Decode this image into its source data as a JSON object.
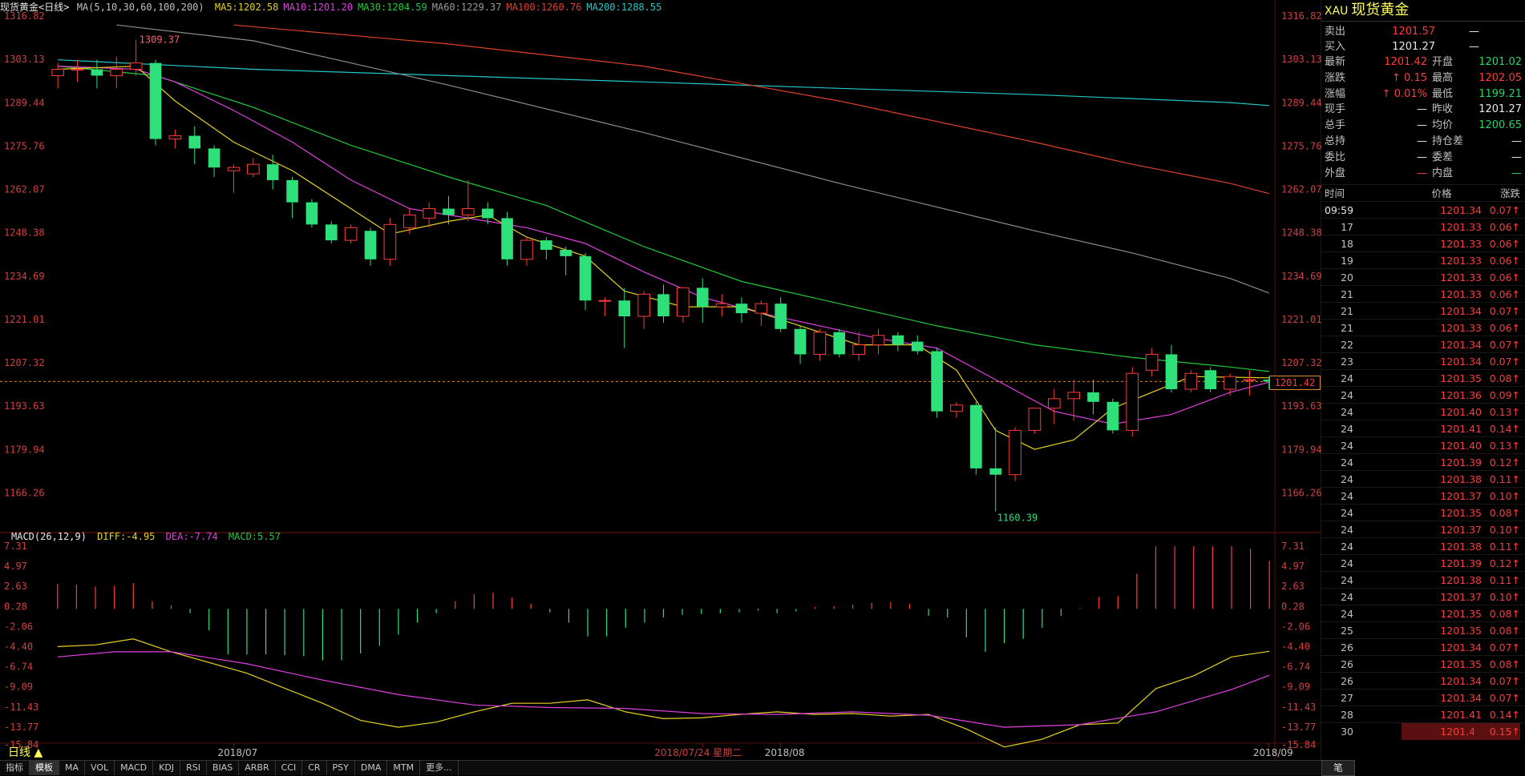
{
  "header": {
    "title": "现货黄金<日线>",
    "ma_label": "MA(5,10,30,60,100,200)",
    "ma": [
      {
        "label": "MA5:1202.58",
        "color": "#e6d21e"
      },
      {
        "label": "MA10:1201.20",
        "color": "#e040e0"
      },
      {
        "label": "MA30:1204.59",
        "color": "#22c83a"
      },
      {
        "label": "MA60:1229.37",
        "color": "#9a9a9a"
      },
      {
        "label": "MA100:1260.76",
        "color": "#e0402a"
      },
      {
        "label": "MA200:1288.55",
        "color": "#24c8c8"
      }
    ]
  },
  "macd_header": {
    "label": "MACD(26,12,9)",
    "diff": "DIFF:-4.95",
    "dea": "DEA:-7.74",
    "macd": "MACD:5.57"
  },
  "price_axis": {
    "labels": [
      "1316.82",
      "1303.13",
      "1289.44",
      "1275.76",
      "1262.07",
      "1248.38",
      "1234.69",
      "1221.01",
      "1207.32",
      "1193.63",
      "1179.94",
      "1166.26"
    ],
    "min": 1155.0,
    "max": 1316.82
  },
  "macd_axis": {
    "labels": [
      "7.31",
      "4.97",
      "2.63",
      "0.28",
      "-2.06",
      "-4.40",
      "-6.74",
      "-9.09",
      "-11.43",
      "-13.77",
      "-15.84"
    ],
    "min": -15.84,
    "max": 7.31
  },
  "current_price": "1201.42",
  "annotations": {
    "high": "1309.37",
    "low": "1160.39"
  },
  "date_labels": [
    {
      "text": "2018/07",
      "bar": 9
    },
    {
      "text": "2018/07/24 星期二",
      "bar": 33
    },
    {
      "text": "2018/08",
      "bar": 37
    },
    {
      "text": "2018/09",
      "bar": 62
    }
  ],
  "period_label": "日线 ▲",
  "bottom_tabs": [
    "指标",
    "模板",
    "MA",
    "VOL",
    "MACD",
    "KDJ",
    "RSI",
    "BIAS",
    "ARBR",
    "CCI",
    "CR",
    "PSY",
    "DMA",
    "MTM",
    "更多..."
  ],
  "chart_data": {
    "type": "candlestick",
    "candles": [
      [
        1298,
        1302,
        1294,
        1300
      ],
      [
        1300,
        1303,
        1296,
        1300
      ],
      [
        1300,
        1303,
        1294,
        1298
      ],
      [
        1298,
        1304,
        1294,
        1300
      ],
      [
        1300,
        1309.37,
        1298,
        1302
      ],
      [
        1302,
        1303,
        1276,
        1278
      ],
      [
        1278,
        1281,
        1275,
        1279
      ],
      [
        1279,
        1282,
        1270,
        1275
      ],
      [
        1275,
        1276,
        1266,
        1269
      ],
      [
        1268,
        1270,
        1261,
        1269
      ],
      [
        1267,
        1272,
        1266,
        1270
      ],
      [
        1270,
        1273,
        1262,
        1265
      ],
      [
        1265,
        1266,
        1253,
        1258
      ],
      [
        1258,
        1259,
        1250,
        1251
      ],
      [
        1251,
        1252,
        1245,
        1246
      ],
      [
        1246,
        1251,
        1245,
        1250
      ],
      [
        1249,
        1250,
        1238,
        1240
      ],
      [
        1240,
        1253,
        1238,
        1251
      ],
      [
        1250,
        1256,
        1248,
        1254
      ],
      [
        1253,
        1258,
        1250,
        1256
      ],
      [
        1256,
        1260,
        1251,
        1254
      ],
      [
        1254,
        1265,
        1252,
        1256
      ],
      [
        1256,
        1258,
        1251,
        1253
      ],
      [
        1253,
        1255,
        1238,
        1240
      ],
      [
        1240,
        1247,
        1238,
        1246
      ],
      [
        1246,
        1247,
        1240,
        1243
      ],
      [
        1243,
        1244,
        1235,
        1241
      ],
      [
        1241,
        1242,
        1224,
        1227
      ],
      [
        1227,
        1228,
        1222,
        1227
      ],
      [
        1227,
        1231,
        1212,
        1222
      ],
      [
        1222,
        1230,
        1218,
        1229
      ],
      [
        1229,
        1232,
        1220,
        1222
      ],
      [
        1222,
        1231,
        1220,
        1231
      ],
      [
        1231,
        1234,
        1220,
        1225
      ],
      [
        1225,
        1229,
        1222,
        1226
      ],
      [
        1226,
        1228,
        1220,
        1223
      ],
      [
        1223,
        1227,
        1219,
        1226
      ],
      [
        1226,
        1228,
        1217,
        1218
      ],
      [
        1218,
        1219,
        1207,
        1210
      ],
      [
        1210,
        1218,
        1208,
        1217
      ],
      [
        1217,
        1218,
        1209,
        1210
      ],
      [
        1210,
        1217,
        1208,
        1213
      ],
      [
        1213,
        1218,
        1210,
        1216
      ],
      [
        1216,
        1217,
        1211,
        1213
      ],
      [
        1214,
        1216,
        1210,
        1211
      ],
      [
        1211,
        1212,
        1190,
        1192
      ],
      [
        1192,
        1195,
        1190,
        1194
      ],
      [
        1194,
        1195,
        1172,
        1174
      ],
      [
        1174,
        1187,
        1160.39,
        1172
      ],
      [
        1172,
        1187,
        1170,
        1186
      ],
      [
        1186,
        1193,
        1185,
        1193
      ],
      [
        1193,
        1199,
        1188,
        1196
      ],
      [
        1196,
        1202,
        1189,
        1198
      ],
      [
        1198,
        1202,
        1191,
        1195
      ],
      [
        1195,
        1196,
        1185,
        1186
      ],
      [
        1186,
        1206,
        1184,
        1204
      ],
      [
        1205,
        1212,
        1203,
        1210
      ],
      [
        1210,
        1213,
        1198,
        1199
      ],
      [
        1199,
        1205,
        1198,
        1204
      ],
      [
        1205,
        1206,
        1198,
        1199
      ],
      [
        1199,
        1204,
        1197,
        1203
      ],
      [
        1202,
        1205,
        1197,
        1202
      ],
      [
        1202,
        1203,
        1199,
        1201.42
      ]
    ],
    "ma": {
      "MA5": [
        [
          0,
          1300
        ],
        [
          4,
          1301
        ],
        [
          6,
          1290
        ],
        [
          9,
          1277
        ],
        [
          12,
          1268
        ],
        [
          15,
          1256
        ],
        [
          17,
          1248
        ],
        [
          20,
          1252
        ],
        [
          22,
          1254
        ],
        [
          24,
          1247
        ],
        [
          27,
          1241
        ],
        [
          29,
          1230
        ],
        [
          32,
          1225
        ],
        [
          35,
          1225
        ],
        [
          38,
          1219
        ],
        [
          41,
          1213
        ],
        [
          44,
          1213
        ],
        [
          46,
          1205
        ],
        [
          48,
          1186
        ],
        [
          50,
          1180
        ],
        [
          52,
          1183
        ],
        [
          54,
          1193
        ],
        [
          56,
          1198
        ],
        [
          58,
          1203
        ],
        [
          60,
          1202.8
        ],
        [
          62,
          1202.58
        ]
      ],
      "MA10": [
        [
          0,
          1301
        ],
        [
          4,
          1300
        ],
        [
          6,
          1296
        ],
        [
          9,
          1287
        ],
        [
          12,
          1277
        ],
        [
          15,
          1265
        ],
        [
          18,
          1256
        ],
        [
          21,
          1253
        ],
        [
          24,
          1250
        ],
        [
          27,
          1245
        ],
        [
          30,
          1236
        ],
        [
          33,
          1228
        ],
        [
          36,
          1223
        ],
        [
          39,
          1219
        ],
        [
          42,
          1215
        ],
        [
          45,
          1212
        ],
        [
          48,
          1202
        ],
        [
          51,
          1192
        ],
        [
          54,
          1188
        ],
        [
          57,
          1191
        ],
        [
          60,
          1198
        ],
        [
          62,
          1201.2
        ]
      ],
      "MA30": [
        [
          0,
          1301
        ],
        [
          5,
          1298
        ],
        [
          10,
          1288
        ],
        [
          15,
          1276
        ],
        [
          20,
          1266
        ],
        [
          25,
          1257
        ],
        [
          30,
          1244
        ],
        [
          35,
          1233
        ],
        [
          40,
          1226
        ],
        [
          45,
          1219
        ],
        [
          50,
          1213
        ],
        [
          55,
          1209
        ],
        [
          60,
          1206
        ],
        [
          62,
          1204.59
        ]
      ],
      "MA60": [
        [
          3,
          1314
        ],
        [
          10,
          1309
        ],
        [
          20,
          1295
        ],
        [
          30,
          1280
        ],
        [
          40,
          1264
        ],
        [
          50,
          1249
        ],
        [
          55,
          1242
        ],
        [
          60,
          1234
        ],
        [
          62,
          1229.37
        ]
      ],
      "MA100": [
        [
          9,
          1314
        ],
        [
          20,
          1308
        ],
        [
          30,
          1301
        ],
        [
          40,
          1290
        ],
        [
          50,
          1277
        ],
        [
          55,
          1270
        ],
        [
          60,
          1264
        ],
        [
          62,
          1260.76
        ]
      ],
      "MA200": [
        [
          0,
          1303
        ],
        [
          10,
          1300
        ],
        [
          20,
          1298
        ],
        [
          30,
          1296
        ],
        [
          40,
          1294
        ],
        [
          50,
          1292
        ],
        [
          60,
          1289.5
        ],
        [
          62,
          1288.55
        ]
      ]
    },
    "macd": {
      "hist": [
        2.9,
        2.8,
        2.6,
        2.7,
        3.0,
        0.9,
        0.4,
        -0.5,
        -2.5,
        -5.3,
        -5.3,
        -5.3,
        -5.4,
        -5.5,
        -6.0,
        -6.0,
        -5.2,
        -4.3,
        -3.0,
        -1.6,
        -0.5,
        0.9,
        1.7,
        1.9,
        1.3,
        0.6,
        -0.4,
        -1.6,
        -3.2,
        -3.2,
        -2.2,
        -1.6,
        -1.0,
        -0.7,
        -0.6,
        -0.5,
        -0.4,
        -0.2,
        -0.5,
        -0.3,
        0.2,
        0.3,
        0.5,
        0.7,
        0.8,
        0.6,
        -0.8,
        -1.0,
        -3.3,
        -5.0,
        -4.0,
        -3.5,
        -2.2,
        -0.8,
        0.1,
        1.4,
        1.5,
        4.1,
        7.3,
        7.3,
        7.3,
        7.3,
        7.3,
        7.0,
        5.6
      ],
      "diff": [
        [
          0,
          -4.4
        ],
        [
          2,
          -4.2
        ],
        [
          4,
          -3.5
        ],
        [
          6,
          -5.0
        ],
        [
          10,
          -7.5
        ],
        [
          14,
          -11.0
        ],
        [
          16,
          -13.0
        ],
        [
          18,
          -13.8
        ],
        [
          20,
          -13.2
        ],
        [
          22,
          -12.0
        ],
        [
          24,
          -11.0
        ],
        [
          26,
          -11.0
        ],
        [
          28,
          -10.6
        ],
        [
          30,
          -12.0
        ],
        [
          32,
          -12.8
        ],
        [
          34,
          -12.7
        ],
        [
          36,
          -12.3
        ],
        [
          38,
          -12.0
        ],
        [
          40,
          -12.3
        ],
        [
          42,
          -12.2
        ],
        [
          44,
          -12.5
        ],
        [
          46,
          -12.3
        ],
        [
          48,
          -14.0
        ],
        [
          50,
          -16.1
        ],
        [
          52,
          -15.2
        ],
        [
          54,
          -13.5
        ],
        [
          56,
          -13.3
        ],
        [
          58,
          -9.3
        ],
        [
          60,
          -7.8
        ],
        [
          62,
          -5.6
        ],
        [
          64,
          -4.95
        ]
      ],
      "dea": [
        [
          0,
          -5.6
        ],
        [
          3,
          -5.0
        ],
        [
          6,
          -5.0
        ],
        [
          10,
          -6.4
        ],
        [
          14,
          -8.3
        ],
        [
          18,
          -10.0
        ],
        [
          22,
          -11.2
        ],
        [
          26,
          -11.5
        ],
        [
          30,
          -11.6
        ],
        [
          34,
          -12.2
        ],
        [
          38,
          -12.3
        ],
        [
          42,
          -12.0
        ],
        [
          46,
          -12.4
        ],
        [
          50,
          -13.8
        ],
        [
          54,
          -13.5
        ],
        [
          58,
          -12.0
        ],
        [
          62,
          -9.4
        ],
        [
          64,
          -7.74
        ]
      ]
    }
  },
  "quote": {
    "symbol": "XAU",
    "name": "现货黄金",
    "rows_left": [
      {
        "label": "卖出",
        "value": "1201.57",
        "extra": "—"
      },
      {
        "label": "买入",
        "value": "1201.27",
        "extra": "—"
      }
    ],
    "rows_pair": [
      {
        "l1": "最新",
        "v1": "1201.42",
        "c1": "red",
        "l2": "开盘",
        "v2": "1201.02",
        "c2": "grn"
      },
      {
        "l1": "涨跌",
        "v1": "↑ 0.15",
        "c1": "red",
        "l2": "最高",
        "v2": "1202.05",
        "c2": "red"
      },
      {
        "l1": "涨幅",
        "v1": "↑ 0.01%",
        "c1": "red",
        "l2": "最低",
        "v2": "1199.21",
        "c2": "grn"
      },
      {
        "l1": "现手",
        "v1": "—",
        "c1": "wht",
        "l2": "昨收",
        "v2": "1201.27",
        "c2": "wht"
      },
      {
        "l1": "总手",
        "v1": "—",
        "c1": "wht",
        "l2": "均价",
        "v2": "1200.65",
        "c2": "grn"
      },
      {
        "l1": "总持",
        "v1": "—",
        "c1": "wht",
        "l2": "持仓差",
        "v2": "—",
        "c2": "wht"
      },
      {
        "l1": "委比",
        "v1": "—",
        "c1": "wht",
        "l2": "委差",
        "v2": "—",
        "c2": "wht"
      },
      {
        "l1": "外盘",
        "v1": "—",
        "c1": "red",
        "l2": "内盘",
        "v2": "—",
        "c2": "grn"
      }
    ],
    "tick_header": {
      "time": "时间",
      "price": "价格",
      "change": "涨跌"
    },
    "ticks": [
      {
        "t": "09:59",
        "p": "1201.34",
        "c": "0.07↑"
      },
      {
        "t": "17",
        "p": "1201.33",
        "c": "0.06↑"
      },
      {
        "t": "18",
        "p": "1201.33",
        "c": "0.06↑"
      },
      {
        "t": "19",
        "p": "1201.33",
        "c": "0.06↑"
      },
      {
        "t": "20",
        "p": "1201.33",
        "c": "0.06↑"
      },
      {
        "t": "21",
        "p": "1201.33",
        "c": "0.06↑"
      },
      {
        "t": "21",
        "p": "1201.34",
        "c": "0.07↑"
      },
      {
        "t": "21",
        "p": "1201.33",
        "c": "0.06↑"
      },
      {
        "t": "22",
        "p": "1201.34",
        "c": "0.07↑"
      },
      {
        "t": "23",
        "p": "1201.34",
        "c": "0.07↑"
      },
      {
        "t": "24",
        "p": "1201.35",
        "c": "0.08↑"
      },
      {
        "t": "24",
        "p": "1201.36",
        "c": "0.09↑"
      },
      {
        "t": "24",
        "p": "1201.40",
        "c": "0.13↑"
      },
      {
        "t": "24",
        "p": "1201.41",
        "c": "0.14↑"
      },
      {
        "t": "24",
        "p": "1201.40",
        "c": "0.13↑"
      },
      {
        "t": "24",
        "p": "1201.39",
        "c": "0.12↑"
      },
      {
        "t": "24",
        "p": "1201.38",
        "c": "0.11↑"
      },
      {
        "t": "24",
        "p": "1201.37",
        "c": "0.10↑"
      },
      {
        "t": "24",
        "p": "1201.35",
        "c": "0.08↑"
      },
      {
        "t": "24",
        "p": "1201.37",
        "c": "0.10↑"
      },
      {
        "t": "24",
        "p": "1201.38",
        "c": "0.11↑"
      },
      {
        "t": "24",
        "p": "1201.39",
        "c": "0.12↑"
      },
      {
        "t": "24",
        "p": "1201.38",
        "c": "0.11↑"
      },
      {
        "t": "24",
        "p": "1201.37",
        "c": "0.10↑"
      },
      {
        "t": "24",
        "p": "1201.35",
        "c": "0.08↑"
      },
      {
        "t": "25",
        "p": "1201.35",
        "c": "0.08↑"
      },
      {
        "t": "26",
        "p": "1201.34",
        "c": "0.07↑"
      },
      {
        "t": "26",
        "p": "1201.35",
        "c": "0.08↑"
      },
      {
        "t": "26",
        "p": "1201.34",
        "c": "0.07↑"
      },
      {
        "t": "27",
        "p": "1201.34",
        "c": "0.07↑"
      },
      {
        "t": "28",
        "p": "1201.41",
        "c": "0.14↑"
      },
      {
        "t": "30",
        "p": "1201.42",
        "c": "0.15↑"
      }
    ],
    "bottom_button": "笔"
  }
}
